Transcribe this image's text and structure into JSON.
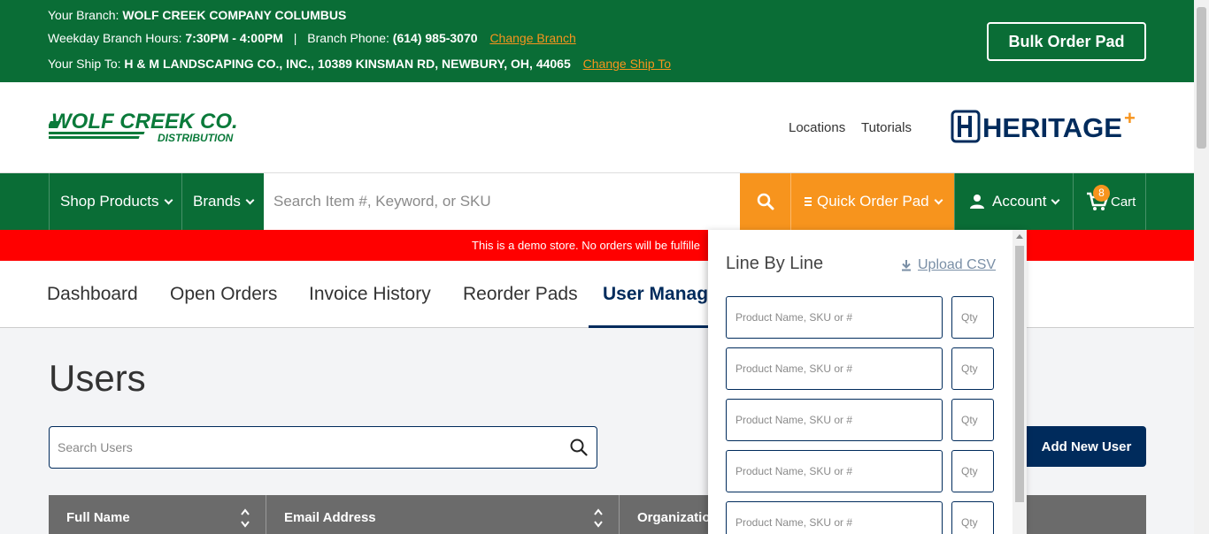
{
  "topbar": {
    "branch_label": "Your Branch:",
    "branch_value": "WOLF CREEK COMPANY COLUMBUS",
    "hours_label": "Weekday Branch Hours:",
    "hours_value": "7:30PM - 4:00PM",
    "separator": "|",
    "phone_label": "Branch Phone:",
    "phone_value": "(614) 985-3070",
    "change_branch": "Change Branch",
    "shipto_label": "Your Ship To:",
    "shipto_value": "H & M LANDSCAPING CO., INC., 10389 KINSMAN RD, NEWBURY, OH, 44065",
    "change_shipto": "Change Ship To",
    "bulk_order": "Bulk Order Pad"
  },
  "header": {
    "logo_main": "WOLF CREEK CO.",
    "logo_sub": "DISTRIBUTION",
    "links": [
      "Locations",
      "Tutorials"
    ],
    "partner_logo": "HERITAGE",
    "partner_plus": "+"
  },
  "nav": {
    "shop_products": "Shop Products",
    "brands": "Brands",
    "search_placeholder": "Search Item #, Keyword, or SKU",
    "quick_order_pad": "Quick Order Pad",
    "account": "Account",
    "cart": "Cart",
    "cart_count": "8"
  },
  "banner": {
    "text": "This is a demo store. No orders will be fulfille"
  },
  "tabs": [
    "Dashboard",
    "Open Orders",
    "Invoice History",
    "Reorder Pads",
    "User Manag"
  ],
  "main": {
    "title": "Users",
    "search_placeholder": "Search Users",
    "add_user": "Add New User",
    "columns": [
      "Full Name",
      "Email Address",
      "Organizatio"
    ]
  },
  "quick_order": {
    "title": "Line By Line",
    "upload_csv": "Upload CSV",
    "product_placeholder": "Product Name, SKU or #",
    "qty_placeholder": "Qty",
    "row_count": 5
  },
  "colors": {
    "brand_green": "#0a6d36",
    "accent_orange": "#f7941d",
    "navy": "#002b5c",
    "demo_red": "#ff0000"
  }
}
